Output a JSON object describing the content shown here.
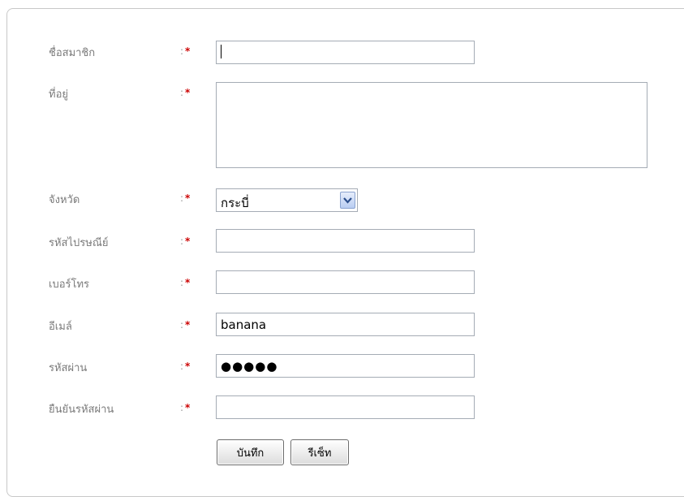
{
  "form": {
    "fields": [
      {
        "label": "ชื่อสมาชิก",
        "colon": ":",
        "star": "*",
        "value": ""
      },
      {
        "label": "ที่อยู่",
        "colon": ":",
        "star": "*",
        "value": ""
      },
      {
        "label": "จังหวัด",
        "colon": ":",
        "star": "*",
        "value": "กระบี่"
      },
      {
        "label": "รหัสไปรษณีย์",
        "colon": ":",
        "star": "*",
        "value": ""
      },
      {
        "label": "เบอร์โทร",
        "colon": ":",
        "star": "*",
        "value": ""
      },
      {
        "label": "อีเมล์",
        "colon": ":",
        "star": "*",
        "value": "banana"
      },
      {
        "label": "รหัสผ่าน",
        "colon": ":",
        "star": "*",
        "value": "●●●●●"
      },
      {
        "label": "ยืนยันรหัสผ่าน",
        "colon": ":",
        "star": "*",
        "value": ""
      }
    ],
    "province_icon": "chevron-down-icon",
    "save_label": "บันทึก",
    "reset_label": "รีเซ็ท",
    "required_color": "#cc0000"
  }
}
